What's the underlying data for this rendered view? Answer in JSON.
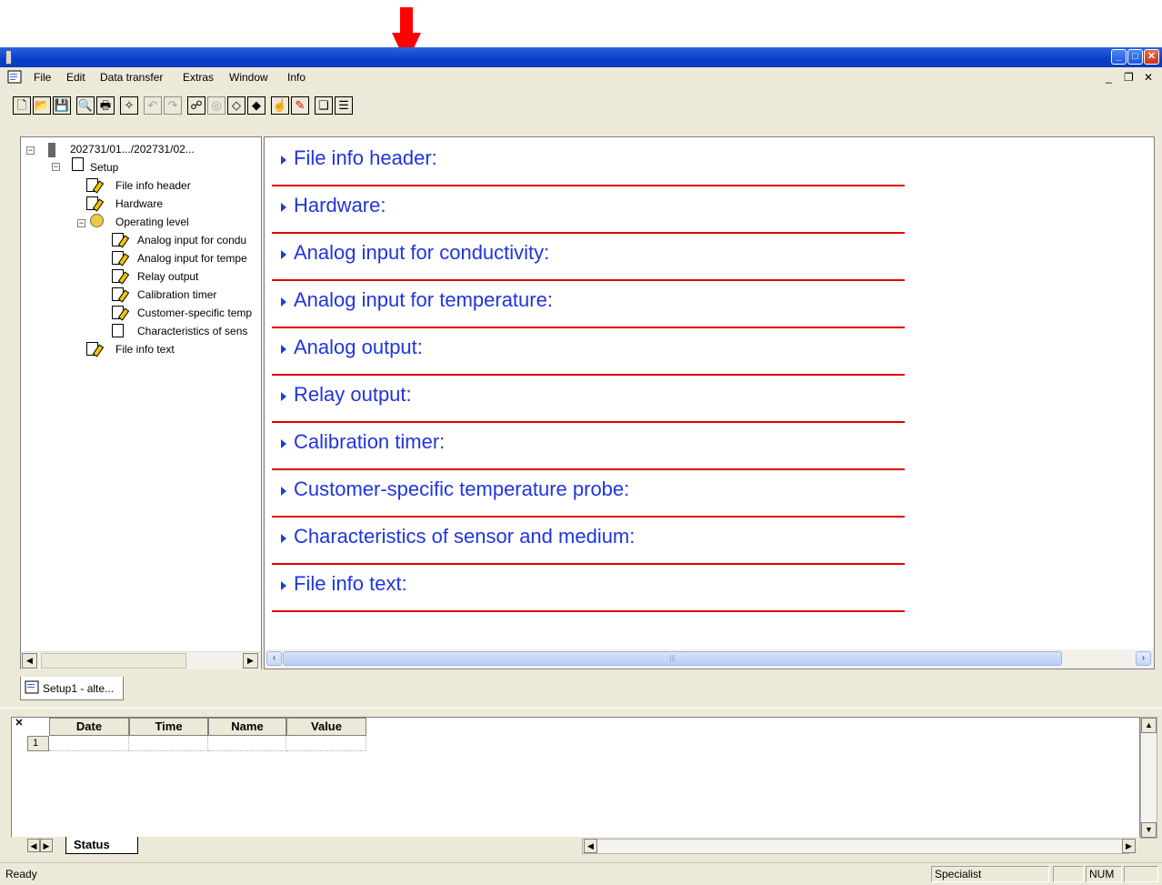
{
  "window": {
    "title": "",
    "controls": {
      "minimize": "_",
      "maximize": "□",
      "close": "✕"
    },
    "mdi_controls": {
      "minimize": "_",
      "restore": "❐",
      "close": "✕"
    }
  },
  "menu": [
    "File",
    "Edit",
    "Data transfer",
    "Extras",
    "Window",
    "Info"
  ],
  "toolbar": {
    "buttons": [
      {
        "name": "new-icon",
        "glyph": "🗋"
      },
      {
        "name": "open-icon",
        "glyph": "📂"
      },
      {
        "name": "save-icon",
        "glyph": "💾"
      },
      {
        "name": "print-preview-icon",
        "glyph": "🔍"
      },
      {
        "name": "print-icon",
        "glyph": "🖶"
      },
      {
        "name": "wizard-icon",
        "glyph": "✧"
      },
      {
        "name": "undo-icon",
        "glyph": "↶"
      },
      {
        "name": "redo-icon",
        "glyph": "↷"
      },
      {
        "name": "connection-icon",
        "glyph": "☍"
      },
      {
        "name": "device-icon",
        "glyph": "◎"
      },
      {
        "name": "transfer-to-device-icon",
        "glyph": "◇"
      },
      {
        "name": "transfer-from-device-icon",
        "glyph": "◆"
      },
      {
        "name": "hand-icon",
        "glyph": "☝"
      },
      {
        "name": "pencil-icon",
        "glyph": "✎"
      },
      {
        "name": "cascade-windows-icon",
        "glyph": "❏"
      },
      {
        "name": "tile-windows-icon",
        "glyph": "☰"
      }
    ],
    "annotation": "red-arrow-pointing-to-pencil-button"
  },
  "tree": {
    "root": "202731/01.../202731/02...",
    "setup": "Setup",
    "items": [
      {
        "label": "File info header",
        "depth": 2
      },
      {
        "label": "Hardware",
        "depth": 2
      },
      {
        "label": "Operating level",
        "depth": 2
      },
      {
        "label": "Analog input for condu",
        "depth": 3
      },
      {
        "label": "Analog input for tempe",
        "depth": 3
      },
      {
        "label": "Relay output",
        "depth": 3
      },
      {
        "label": "Calibration timer",
        "depth": 3
      },
      {
        "label": "Customer-specific temp",
        "depth": 3
      },
      {
        "label": "Characteristics of sens",
        "depth": 3
      },
      {
        "label": "File info text",
        "depth": 2
      }
    ]
  },
  "sections": [
    "File info header:",
    "Hardware:",
    "Analog input for conductivity:",
    "Analog input for temperature:",
    "Analog output:",
    "Relay output:",
    "Calibration timer:",
    "Customer-specific temperature probe:",
    "Characteristics of sensor and medium:",
    "File info text:"
  ],
  "doc_tab": "Setup1 - alte...",
  "status_table": {
    "columns": [
      "Date",
      "Time",
      "Name",
      "Value"
    ],
    "rows": [
      [
        "1",
        "",
        "",
        "",
        ""
      ]
    ]
  },
  "sheet_tab": "Status",
  "statusbar": {
    "text": "Ready",
    "user": "Specialist",
    "num": "NUM"
  },
  "colors": {
    "section_text": "#1f35e0",
    "section_rule": "#e00000",
    "titlebar": "#0a3ec8",
    "arrow": "#ff0000"
  }
}
